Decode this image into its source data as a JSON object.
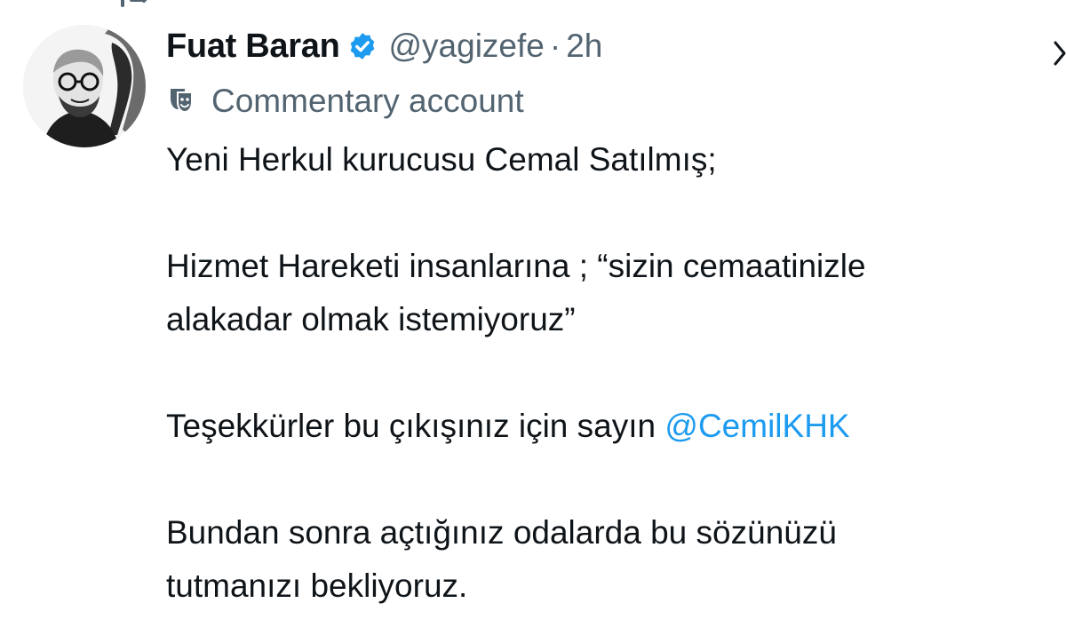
{
  "tweet": {
    "author": {
      "display_name": "Fuat Baran",
      "handle": "@yagizefe",
      "verified": true
    },
    "separator": "·",
    "time": "2h",
    "label": "Commentary account",
    "body": {
      "p1": "Yeni Herkul kurucusu Cemal Satılmış;",
      "p2_line1": "Hizmet Hareketi insanlarına ;  “sizin cemaatinizle",
      "p2_line2": "alakadar olmak istemiyoruz”",
      "p3_prefix": "Teşekkürler bu çıkışınız için sayın ",
      "p3_mention": "@CemilKHK",
      "p4_line1": "Bundan sonra açtığınız odalarda bu sözünüzü",
      "p4_line2": "tutmanızı bekliyoruz."
    }
  },
  "icons": {
    "repost": "repost-icon",
    "verified": "verified-badge-icon",
    "label": "theater-masks-icon",
    "more": "chevron-right-icon"
  },
  "colors": {
    "primary_text": "#0f1419",
    "secondary_text": "#536471",
    "link": "#1d9bf0",
    "verified": "#1d9bf0"
  }
}
